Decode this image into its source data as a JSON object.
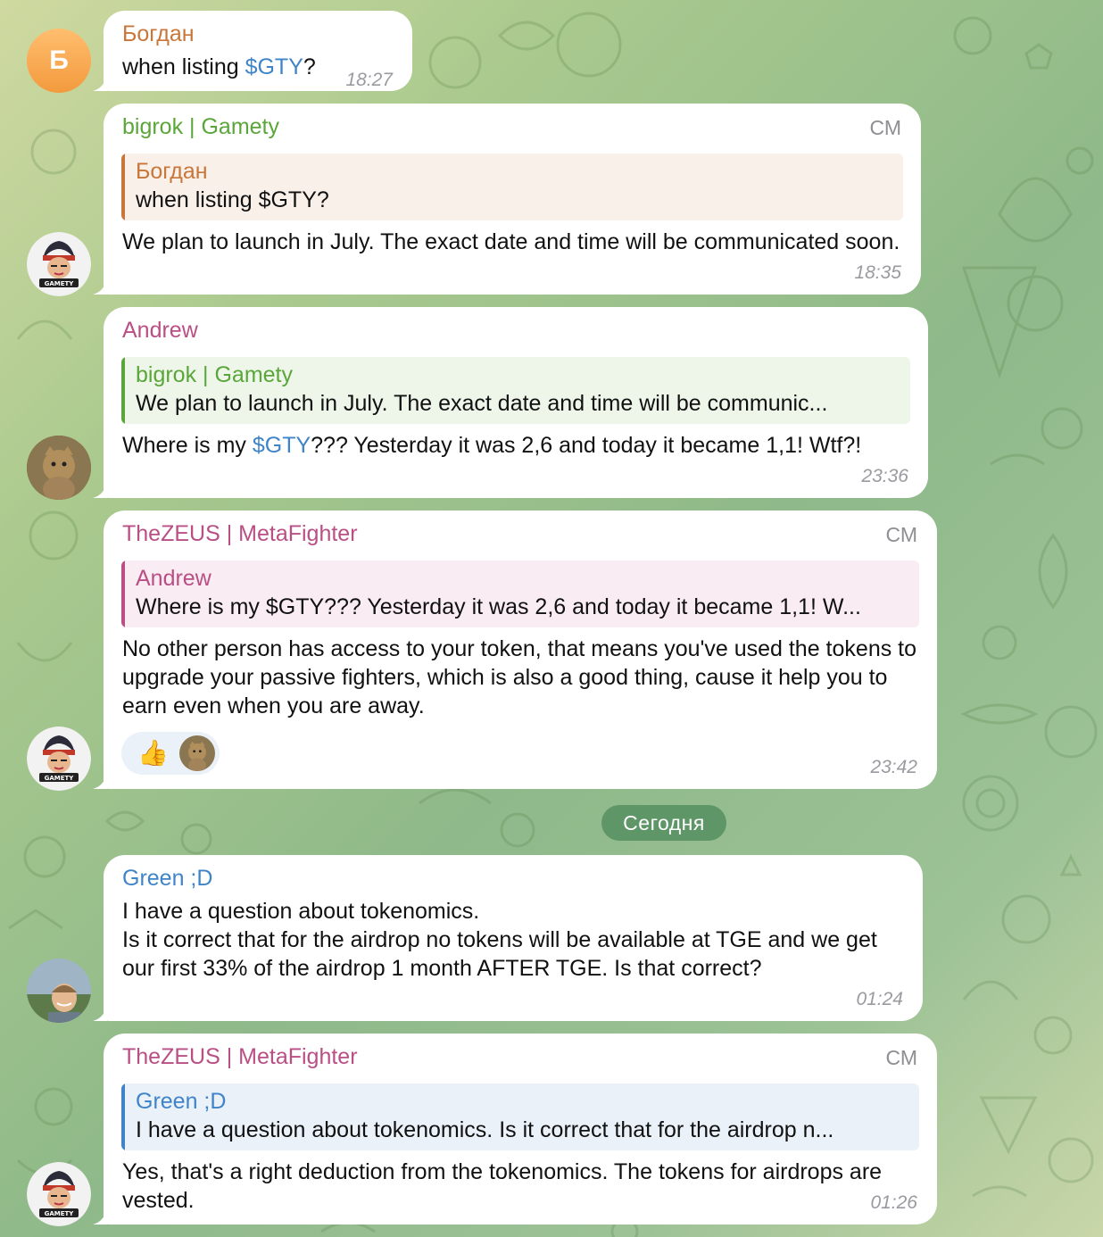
{
  "colors": {
    "bogdan": "#c8763a",
    "bigrok": "#5aa63a",
    "andrew": "#b94f85",
    "zeus": "#b94f85",
    "green": "#3f84c8",
    "link": "#3f84c8"
  },
  "date_separator": "Сегодня",
  "messages": [
    {
      "id": "m1",
      "avatar_letter": "Б",
      "sender": "Богдан",
      "text_before": "when listing ",
      "link": "$GTY",
      "text_after": "?",
      "time": "18:27"
    },
    {
      "id": "m2",
      "sender": "bigrok | Gamety",
      "role": "СМ",
      "quote_name": "Богдан",
      "quote_text": "when listing $GTY?",
      "text": "We plan to launch in July. The exact date and time will be communicated soon.",
      "time": "18:35"
    },
    {
      "id": "m3",
      "sender": "Andrew",
      "quote_name": "bigrok | Gamety",
      "quote_text": "We plan to launch in July. The exact date and time will be communic...",
      "text_before": "Where is my ",
      "link": "$GTY",
      "text_after": "??? Yesterday it was 2,6 and today it became 1,1! Wtf?!",
      "time": "23:36"
    },
    {
      "id": "m4",
      "sender": "TheZEUS | MetaFighter",
      "role": "СМ",
      "quote_name": "Andrew",
      "quote_text": "Where is my $GTY??? Yesterday it was 2,6 and today it became 1,1! W...",
      "text": "No other person has access to your token, that means you've used the tokens to upgrade your passive fighters, which is also a good thing, cause it help you to earn even when you are away.",
      "reaction_emoji": "👍",
      "time": "23:42"
    },
    {
      "id": "m5",
      "sender": "Green ;D",
      "text_line1": "I have a question about tokenomics.",
      "text_line2": "Is it correct that for the airdrop no tokens will be available at TGE and we get our first 33% of the airdrop 1 month AFTER TGE. Is that correct?",
      "time": "01:24"
    },
    {
      "id": "m6",
      "sender": "TheZEUS | MetaFighter",
      "role": "СМ",
      "quote_name": "Green ;D",
      "quote_text": "I have a question about tokenomics. Is it correct that for the airdrop n...",
      "text": "Yes, that's a right deduction from the tokenomics. The tokens for airdrops are vested.",
      "time": "01:26"
    }
  ]
}
